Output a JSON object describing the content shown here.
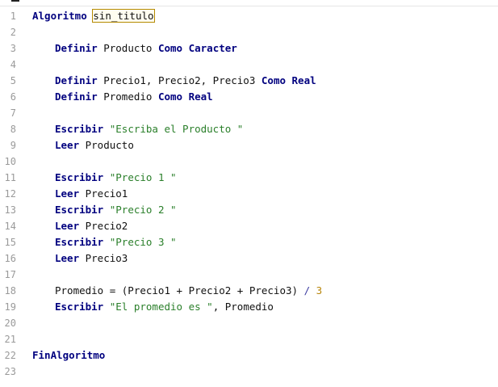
{
  "editor": {
    "lines": [
      {
        "n": "1",
        "tokens": [
          {
            "t": "kw",
            "v": "Algoritmo"
          },
          {
            "t": "tx",
            "v": " "
          },
          {
            "t": "hl",
            "v": "sin_titulo"
          }
        ]
      },
      {
        "n": "2",
        "tokens": []
      },
      {
        "n": "3",
        "indent": true,
        "tokens": [
          {
            "t": "kw",
            "v": "Definir"
          },
          {
            "t": "tx",
            "v": " Producto "
          },
          {
            "t": "kw",
            "v": "Como"
          },
          {
            "t": "tx",
            "v": " "
          },
          {
            "t": "kw",
            "v": "Caracter"
          }
        ]
      },
      {
        "n": "4",
        "tokens": []
      },
      {
        "n": "5",
        "indent": true,
        "tokens": [
          {
            "t": "kw",
            "v": "Definir"
          },
          {
            "t": "tx",
            "v": " Precio1, Precio2, Precio3 "
          },
          {
            "t": "kw",
            "v": "Como"
          },
          {
            "t": "tx",
            "v": " "
          },
          {
            "t": "kw",
            "v": "Real"
          }
        ]
      },
      {
        "n": "6",
        "indent": true,
        "tokens": [
          {
            "t": "kw",
            "v": "Definir"
          },
          {
            "t": "tx",
            "v": " Promedio "
          },
          {
            "t": "kw",
            "v": "Como"
          },
          {
            "t": "tx",
            "v": " "
          },
          {
            "t": "kw",
            "v": "Real"
          }
        ]
      },
      {
        "n": "7",
        "tokens": []
      },
      {
        "n": "8",
        "indent": true,
        "tokens": [
          {
            "t": "kw",
            "v": "Escribir"
          },
          {
            "t": "tx",
            "v": " "
          },
          {
            "t": "str",
            "v": "\"Escriba el Producto \""
          }
        ]
      },
      {
        "n": "9",
        "indent": true,
        "tokens": [
          {
            "t": "kw",
            "v": "Leer"
          },
          {
            "t": "tx",
            "v": " Producto"
          }
        ]
      },
      {
        "n": "10",
        "tokens": []
      },
      {
        "n": "11",
        "indent": true,
        "tokens": [
          {
            "t": "kw",
            "v": "Escribir"
          },
          {
            "t": "tx",
            "v": " "
          },
          {
            "t": "str",
            "v": "\"Precio 1 \""
          }
        ]
      },
      {
        "n": "12",
        "indent": true,
        "tokens": [
          {
            "t": "kw",
            "v": "Leer"
          },
          {
            "t": "tx",
            "v": " Precio1"
          }
        ]
      },
      {
        "n": "13",
        "indent": true,
        "tokens": [
          {
            "t": "kw",
            "v": "Escribir"
          },
          {
            "t": "tx",
            "v": " "
          },
          {
            "t": "str",
            "v": "\"Precio 2 \""
          }
        ]
      },
      {
        "n": "14",
        "indent": true,
        "tokens": [
          {
            "t": "kw",
            "v": "Leer"
          },
          {
            "t": "tx",
            "v": " Precio2"
          }
        ]
      },
      {
        "n": "15",
        "indent": true,
        "tokens": [
          {
            "t": "kw",
            "v": "Escribir"
          },
          {
            "t": "tx",
            "v": " "
          },
          {
            "t": "str",
            "v": "\"Precio 3 \""
          }
        ]
      },
      {
        "n": "16",
        "indent": true,
        "tokens": [
          {
            "t": "kw",
            "v": "Leer"
          },
          {
            "t": "tx",
            "v": " Precio3"
          }
        ]
      },
      {
        "n": "17",
        "tokens": []
      },
      {
        "n": "18",
        "indent": true,
        "tokens": [
          {
            "t": "tx",
            "v": "Promedio = (Precio1 + Precio2 + Precio3) "
          },
          {
            "t": "op",
            "v": "/"
          },
          {
            "t": "tx",
            "v": " "
          },
          {
            "t": "num",
            "v": "3"
          }
        ]
      },
      {
        "n": "19",
        "indent": true,
        "tokens": [
          {
            "t": "kw",
            "v": "Escribir"
          },
          {
            "t": "tx",
            "v": " "
          },
          {
            "t": "str",
            "v": "\"El promedio es \""
          },
          {
            "t": "tx",
            "v": ", Promedio"
          }
        ]
      },
      {
        "n": "20",
        "tokens": []
      },
      {
        "n": "21",
        "tokens": []
      },
      {
        "n": "22",
        "tokens": [
          {
            "t": "kw",
            "v": "FinAlgoritmo"
          }
        ]
      },
      {
        "n": "23",
        "tokens": []
      }
    ]
  },
  "colors": {
    "keyword": "#00007f",
    "string": "#2a7f2a",
    "number": "#b8860b",
    "line_number": "#9a9a9a",
    "highlight_border": "#b58a00"
  }
}
